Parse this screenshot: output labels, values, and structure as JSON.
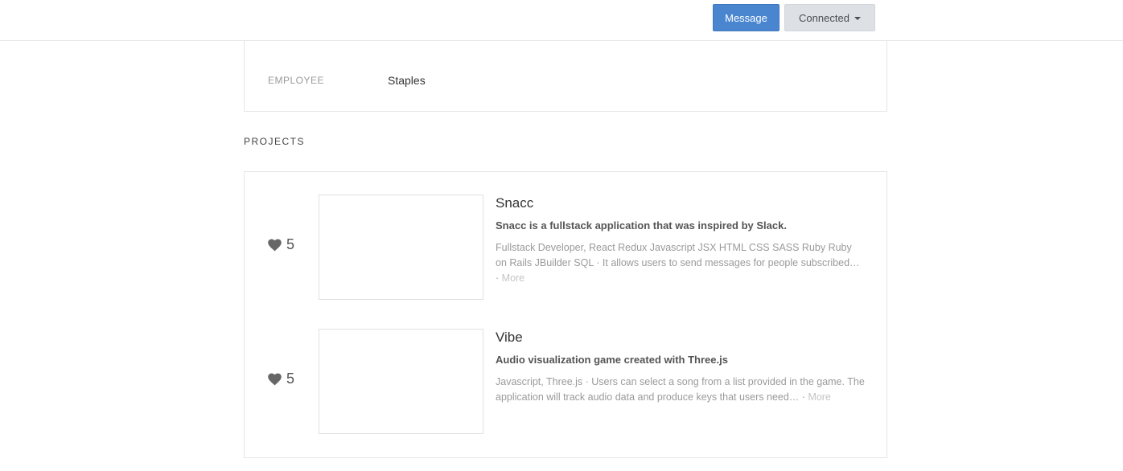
{
  "header": {
    "message_label": "Message",
    "connected_label": "Connected"
  },
  "employee": {
    "label": "EMPLOYEE",
    "value": "Staples"
  },
  "projects": {
    "section_title": "PROJECTS",
    "items": [
      {
        "likes": "5",
        "title": "Snacc",
        "tagline": "Snacc is a fullstack application that was inspired by Slack.",
        "description": "Fullstack Developer, React Redux Javascript JSX HTML CSS SASS Ruby Ruby on Rails JBuilder SQL · It allows users to send messages for people subscribed… ·",
        "more_label": "More"
      },
      {
        "likes": "5",
        "title": "Vibe",
        "tagline": "Audio visualization game created with Three.js",
        "description": "Javascript, Three.js · Users can select a song from a list provided in the game. The application will track audio data and produce keys that users need… ·",
        "more_label": "More"
      }
    ]
  },
  "icons": {
    "like": "heart-icon",
    "dropdown": "caret-down-icon"
  },
  "colors": {
    "primary_button": "#4a86cf",
    "secondary_button": "#dde0e4"
  }
}
